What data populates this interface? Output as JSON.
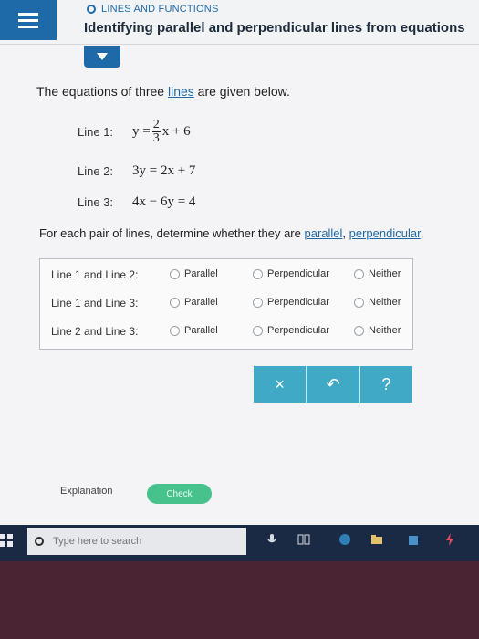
{
  "header": {
    "topic": "LINES AND FUNCTIONS",
    "title": "Identifying parallel and perpendicular lines from equations"
  },
  "intro": {
    "before": "The equations of three ",
    "link": "lines",
    "after": " are given below."
  },
  "lines": [
    {
      "label": "Line 1:"
    },
    {
      "label": "Line 2:"
    },
    {
      "label": "Line 3:"
    }
  ],
  "equations": {
    "line1": {
      "prefix": "y = ",
      "num": "2",
      "den": "3",
      "suffix": "x + 6"
    },
    "line2": "3y = 2x + 7",
    "line3": "4x − 6y = 4"
  },
  "task": {
    "before": "For each pair of lines, determine whether they are ",
    "link1": "parallel",
    "sep": ", ",
    "link2": "perpendicular",
    "after": ","
  },
  "pairs": [
    {
      "label": "Line 1 and Line 2:",
      "options": [
        "Parallel",
        "Perpendicular",
        "Neither"
      ]
    },
    {
      "label": "Line 1 and Line 3:",
      "options": [
        "Parallel",
        "Perpendicular",
        "Neither"
      ]
    },
    {
      "label": "Line 2 and Line 3:",
      "options": [
        "Parallel",
        "Perpendicular",
        "Neither"
      ]
    }
  ],
  "actions": {
    "clear": "×",
    "undo": "↶",
    "help": "?"
  },
  "footer": {
    "explanation": "Explanation",
    "check": "Check"
  },
  "taskbar": {
    "search_placeholder": "Type here to search"
  },
  "colors": {
    "accent": "#1e6aa8",
    "action": "#3fa9c6",
    "check": "#47c28d"
  }
}
